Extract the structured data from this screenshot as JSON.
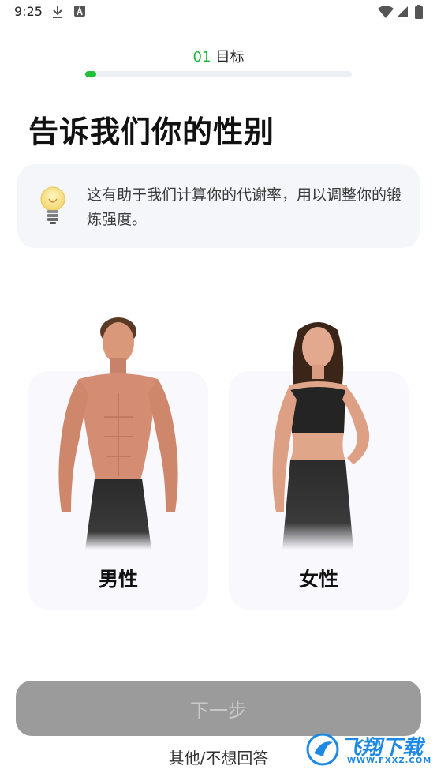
{
  "status_bar": {
    "time": "9:25"
  },
  "progress": {
    "step_number": "01",
    "step_name": "目标",
    "fraction": 0.04
  },
  "title": "告诉我们你的性别",
  "tip": {
    "text": "这有助于我们计算你的代谢率，用以调整你的锻炼强度。"
  },
  "genders": [
    {
      "label": "男性"
    },
    {
      "label": "女性"
    }
  ],
  "next_button": {
    "label": "下一步"
  },
  "skip_link": {
    "label": "其他/不想回答"
  },
  "watermark": {
    "text": "飞翔下载",
    "url": "WWW.FXXZ.COM"
  },
  "colors": {
    "accent": "#1fc13a",
    "button_disabled": "#9b9b9b",
    "card_bg": "#f5f6fa"
  }
}
